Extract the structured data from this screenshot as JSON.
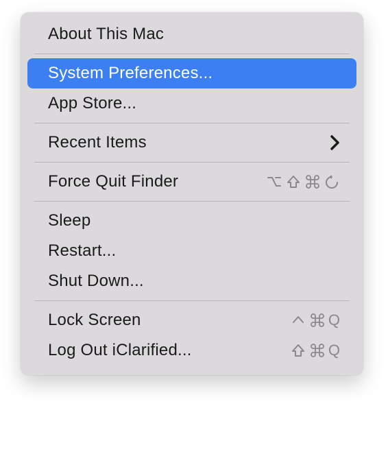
{
  "menu": {
    "about": {
      "label": "About This Mac"
    },
    "system_prefs": {
      "label": "System Preferences..."
    },
    "app_store": {
      "label": "App Store..."
    },
    "recent_items": {
      "label": "Recent Items"
    },
    "force_quit": {
      "label": "Force Quit Finder",
      "shortcut_glyphs": [
        "option",
        "shift",
        "command",
        "escape"
      ]
    },
    "sleep": {
      "label": "Sleep"
    },
    "restart": {
      "label": "Restart..."
    },
    "shut_down": {
      "label": "Shut Down..."
    },
    "lock_screen": {
      "label": "Lock Screen",
      "shortcut_glyphs": [
        "control",
        "command",
        "Q"
      ]
    },
    "log_out": {
      "label": "Log Out iClarified...",
      "shortcut_glyphs": [
        "shift",
        "command",
        "Q"
      ]
    }
  },
  "colors": {
    "highlight": "#3b7ff3",
    "menu_bg": "#dcd9dd"
  }
}
